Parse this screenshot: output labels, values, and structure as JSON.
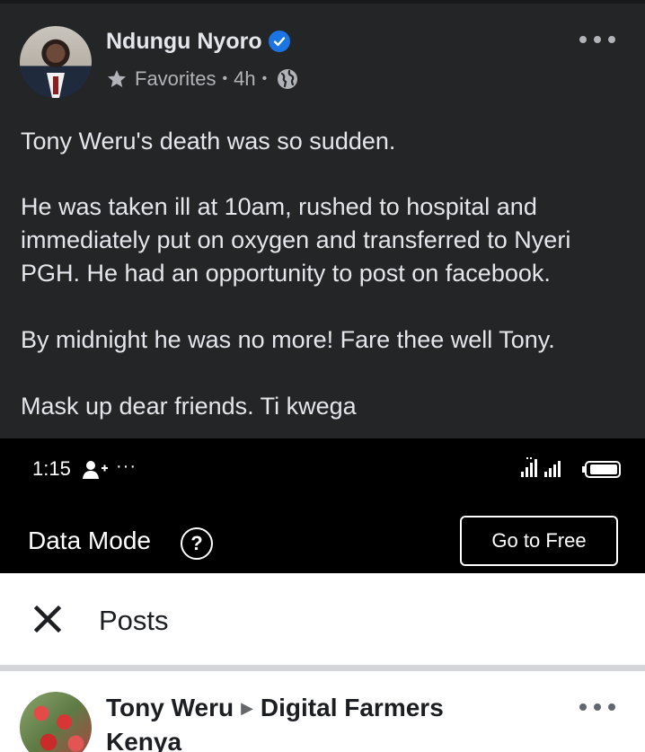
{
  "post": {
    "author": "Ndungu Nyoro",
    "audience": "Favorites",
    "separator": "•",
    "time": "4h",
    "paragraphs": [
      "Tony Weru's death was so sudden.",
      "He was taken ill at 10am, rushed to hospital and",
      "immediately put on oxygen and transferred to Nyeri",
      "PGH. He had an opportunity to post on facebook.",
      "By midnight he was no more! Fare thee well Tony.",
      "Mask up dear friends. Ti kwega"
    ]
  },
  "status_bar": {
    "time": "1:15",
    "overflow": "···"
  },
  "data_mode": {
    "label": "Data Mode",
    "help": "?",
    "button": "Go to Free"
  },
  "posts_header": {
    "title": "Posts"
  },
  "next_post": {
    "author": "Tony Weru",
    "arrow": "▶",
    "group_line1": "Digital Farmers",
    "group_line2": "Kenya"
  },
  "colors": {
    "dark_bg": "#242526",
    "verified_blue": "#1b74e4",
    "status_bar_bg": "#000000",
    "light_bg": "#ffffff"
  },
  "icons": [
    "verified-badge-icon",
    "star-icon",
    "globe-icon",
    "more-icon",
    "person-add-icon",
    "signal-icon",
    "battery-icon",
    "help-icon",
    "close-icon"
  ]
}
